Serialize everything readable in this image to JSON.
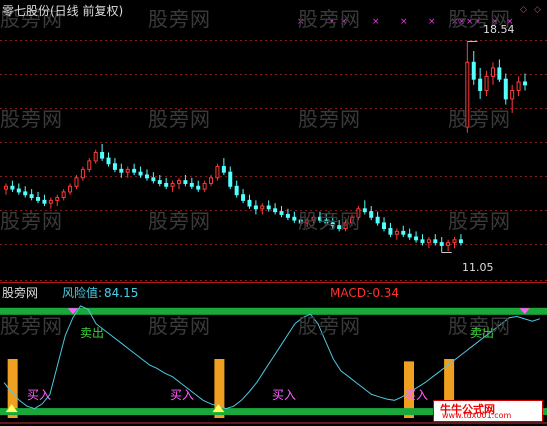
{
  "title": "零七股份(日线 前复权)",
  "watermark": "股旁网",
  "price_panel": {
    "high_label": "18.54",
    "low_label": "11.05",
    "candles": [
      [
        13.3,
        13.5,
        13.1,
        13.4
      ],
      [
        13.4,
        13.6,
        13.2,
        13.3
      ],
      [
        13.3,
        13.5,
        13.1,
        13.2
      ],
      [
        13.2,
        13.4,
        13.0,
        13.1
      ],
      [
        13.1,
        13.3,
        12.9,
        13.0
      ],
      [
        13.0,
        13.2,
        12.8,
        12.9
      ],
      [
        12.9,
        13.1,
        12.7,
        12.8
      ],
      [
        12.8,
        13.0,
        12.6,
        12.9
      ],
      [
        12.9,
        13.1,
        12.7,
        13.0
      ],
      [
        13.0,
        13.3,
        12.9,
        13.2
      ],
      [
        13.2,
        13.5,
        13.1,
        13.4
      ],
      [
        13.4,
        13.8,
        13.3,
        13.7
      ],
      [
        13.7,
        14.1,
        13.6,
        14.0
      ],
      [
        14.0,
        14.4,
        13.9,
        14.3
      ],
      [
        14.3,
        14.7,
        14.2,
        14.6
      ],
      [
        14.6,
        14.9,
        14.3,
        14.4
      ],
      [
        14.4,
        14.6,
        14.1,
        14.2
      ],
      [
        14.2,
        14.4,
        13.9,
        14.0
      ],
      [
        14.0,
        14.2,
        13.7,
        13.9
      ],
      [
        13.9,
        14.1,
        13.7,
        14.0
      ],
      [
        14.0,
        14.2,
        13.8,
        13.9
      ],
      [
        13.9,
        14.1,
        13.7,
        13.8
      ],
      [
        13.8,
        14.0,
        13.6,
        13.7
      ],
      [
        13.7,
        13.9,
        13.5,
        13.6
      ],
      [
        13.6,
        13.8,
        13.4,
        13.5
      ],
      [
        13.5,
        13.7,
        13.3,
        13.4
      ],
      [
        13.4,
        13.6,
        13.2,
        13.5
      ],
      [
        13.5,
        13.7,
        13.3,
        13.6
      ],
      [
        13.6,
        13.8,
        13.4,
        13.5
      ],
      [
        13.5,
        13.7,
        13.3,
        13.4
      ],
      [
        13.4,
        13.6,
        13.2,
        13.3
      ],
      [
        13.3,
        13.6,
        13.2,
        13.5
      ],
      [
        13.5,
        13.8,
        13.4,
        13.7
      ],
      [
        13.7,
        14.2,
        13.6,
        14.1
      ],
      [
        14.1,
        14.4,
        13.8,
        13.9
      ],
      [
        13.9,
        14.1,
        13.3,
        13.4
      ],
      [
        13.4,
        13.6,
        13.0,
        13.1
      ],
      [
        13.1,
        13.3,
        12.8,
        12.9
      ],
      [
        12.9,
        13.1,
        12.6,
        12.7
      ],
      [
        12.7,
        12.9,
        12.4,
        12.6
      ],
      [
        12.6,
        12.8,
        12.4,
        12.7
      ],
      [
        12.7,
        12.9,
        12.5,
        12.6
      ],
      [
        12.6,
        12.8,
        12.4,
        12.5
      ],
      [
        12.5,
        12.7,
        12.3,
        12.4
      ],
      [
        12.4,
        12.6,
        12.2,
        12.3
      ],
      [
        12.3,
        12.5,
        12.1,
        12.2
      ],
      [
        12.2,
        12.4,
        12.0,
        12.1
      ],
      [
        12.1,
        12.3,
        11.95,
        12.2
      ],
      [
        12.2,
        12.4,
        12.0,
        12.3
      ],
      [
        12.3,
        12.5,
        12.1,
        12.2
      ],
      [
        12.2,
        12.4,
        12.0,
        12.1
      ],
      [
        12.1,
        12.3,
        11.9,
        12.0
      ],
      [
        12.0,
        12.2,
        11.8,
        11.9
      ],
      [
        11.9,
        12.2,
        11.8,
        12.1
      ],
      [
        12.1,
        12.4,
        12.0,
        12.3
      ],
      [
        12.3,
        12.7,
        12.2,
        12.6
      ],
      [
        12.6,
        12.9,
        12.4,
        12.5
      ],
      [
        12.5,
        12.7,
        12.2,
        12.3
      ],
      [
        12.3,
        12.5,
        12.0,
        12.1
      ],
      [
        12.1,
        12.3,
        11.8,
        11.9
      ],
      [
        11.9,
        12.1,
        11.6,
        11.7
      ],
      [
        11.7,
        11.9,
        11.5,
        11.8
      ],
      [
        11.8,
        12.0,
        11.6,
        11.7
      ],
      [
        11.7,
        11.9,
        11.5,
        11.6
      ],
      [
        11.6,
        11.8,
        11.4,
        11.5
      ],
      [
        11.5,
        11.7,
        11.3,
        11.4
      ],
      [
        11.4,
        11.6,
        11.2,
        11.5
      ],
      [
        11.5,
        11.7,
        11.3,
        11.4
      ],
      [
        11.4,
        11.6,
        11.05,
        11.3
      ],
      [
        11.3,
        11.5,
        11.1,
        11.4
      ],
      [
        11.4,
        11.6,
        11.2,
        11.5
      ],
      [
        11.5,
        11.7,
        11.3,
        11.4
      ],
      [
        15.5,
        18.54,
        15.3,
        17.8
      ],
      [
        17.8,
        18.2,
        17.0,
        17.2
      ],
      [
        17.2,
        17.6,
        16.5,
        16.8
      ],
      [
        16.8,
        17.5,
        16.6,
        17.3
      ],
      [
        17.3,
        17.8,
        17.0,
        17.6
      ],
      [
        17.6,
        17.9,
        17.1,
        17.2
      ],
      [
        17.2,
        17.4,
        16.3,
        16.5
      ],
      [
        16.5,
        17.0,
        16.0,
        16.8
      ],
      [
        16.8,
        17.3,
        16.6,
        17.1
      ],
      [
        17.1,
        17.4,
        16.8,
        17.0
      ]
    ]
  },
  "indicator_panel": {
    "name": "股旁网",
    "risk_label": "风险值:",
    "risk_value": "84.15",
    "macd_label": "MACD:",
    "macd_value": "-0.34",
    "sell_label": "卖出",
    "buy_label": "买入",
    "upper_level": 90,
    "lower_level": 5,
    "risk_series": [
      30,
      22,
      15,
      10,
      8,
      12,
      20,
      45,
      70,
      85,
      95,
      92,
      80,
      75,
      70,
      65,
      60,
      55,
      50,
      45,
      42,
      38,
      35,
      30,
      25,
      20,
      15,
      12,
      10,
      8,
      10,
      15,
      22,
      30,
      40,
      50,
      60,
      70,
      80,
      85,
      88,
      80,
      65,
      50,
      40,
      35,
      30,
      25,
      20,
      18,
      16,
      15,
      18,
      22,
      26,
      30,
      35,
      40,
      45,
      50,
      55,
      60,
      65,
      70,
      75,
      80,
      85,
      86,
      84,
      82,
      84.15
    ],
    "buy_signals": [
      1,
      28,
      58
    ],
    "sell_signals": [
      9,
      68
    ]
  },
  "logo": {
    "line1": "牛牛公式网",
    "line2": "www.tdx001.com"
  }
}
